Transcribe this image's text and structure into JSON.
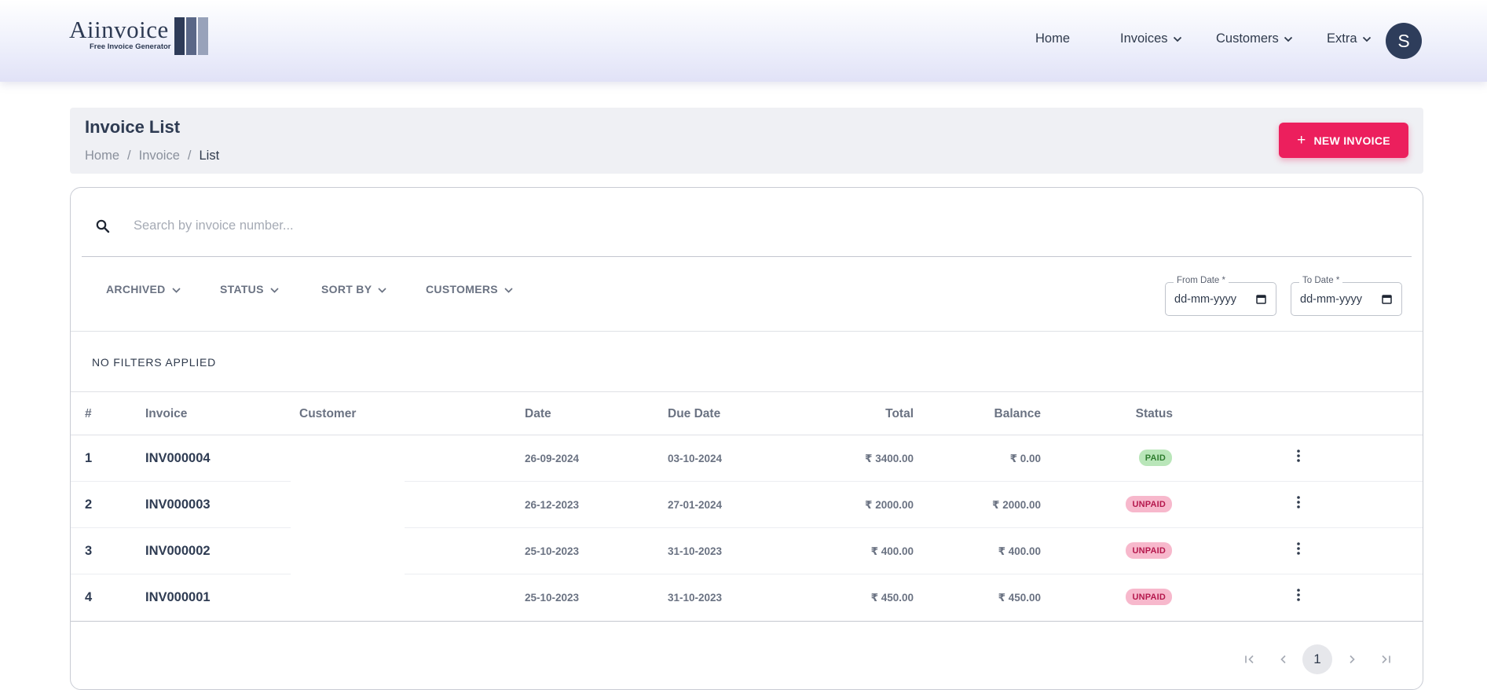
{
  "header": {
    "logo": {
      "text": "Aiinvoice",
      "tagline": "Free Invoice Generator"
    },
    "nav": [
      {
        "label": "Home",
        "has_dropdown": false
      },
      {
        "label": "Invoices",
        "has_dropdown": true
      },
      {
        "label": "Customers",
        "has_dropdown": true
      },
      {
        "label": "Extra",
        "has_dropdown": true
      }
    ],
    "avatar_initial": "S",
    "colors": {
      "avatar": "#2e3d5b"
    }
  },
  "title_bar": {
    "title": "Invoice List",
    "breadcrumb": [
      "Home",
      "Invoice",
      "List"
    ],
    "breadcrumb_separator": "/",
    "new_button": {
      "icon": "plus-icon",
      "label": "NEW INVOICE"
    },
    "colors": {
      "accent": "#ec1f5d"
    }
  },
  "search": {
    "icon": "search-icon",
    "placeholder": "Search by invoice number...",
    "value": ""
  },
  "filters": {
    "dropdowns": [
      "ARCHIVED",
      "STATUS",
      "SORT BY",
      "CUSTOMERS"
    ],
    "from_date": {
      "label": "From Date *",
      "value": "dd-mm-yyyy"
    },
    "to_date": {
      "label": "To Date *",
      "value": "dd-mm-yyyy"
    },
    "applied_text": "NO FILTERS APPLIED"
  },
  "table": {
    "columns": [
      "#",
      "Invoice",
      "Customer",
      "Date",
      "Due Date",
      "Total",
      "Balance",
      "Status"
    ],
    "rows": [
      {
        "num": "1",
        "invoice": "INV000004",
        "customer": "",
        "date": "26-09-2024",
        "due": "03-10-2024",
        "total": "₹ 3400.00",
        "balance": "₹ 0.00",
        "status": "PAID"
      },
      {
        "num": "2",
        "invoice": "INV000003",
        "customer": "",
        "date": "26-12-2023",
        "due": "27-01-2024",
        "total": "₹ 2000.00",
        "balance": "₹ 2000.00",
        "status": "UNPAID"
      },
      {
        "num": "3",
        "invoice": "INV000002",
        "customer": "",
        "date": "25-10-2023",
        "due": "31-10-2023",
        "total": "₹ 400.00",
        "balance": "₹ 400.00",
        "status": "UNPAID"
      },
      {
        "num": "4",
        "invoice": "INV000001",
        "customer": "",
        "date": "25-10-2023",
        "due": "31-10-2023",
        "total": "₹ 450.00",
        "balance": "₹ 450.00",
        "status": "UNPAID"
      }
    ],
    "row_menu_icon": "more-vertical-icon",
    "status_colors": {
      "PAID": "#b9e6b9",
      "UNPAID": "#f7b8cc"
    }
  },
  "pagination": {
    "current_page": "1",
    "icons": [
      "first-page-icon",
      "previous-page-icon",
      "next-page-icon",
      "last-page-icon"
    ]
  }
}
